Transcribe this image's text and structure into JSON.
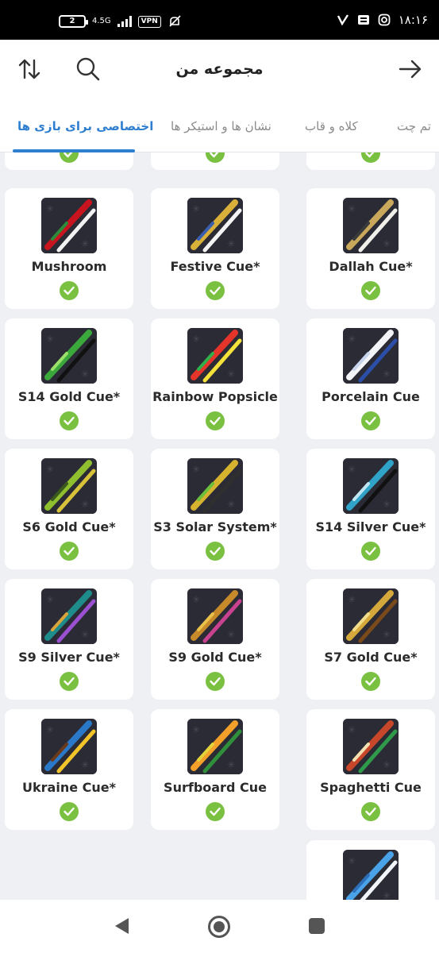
{
  "status_bar": {
    "battery": "2",
    "network": "4.5G",
    "vpn": "VPN",
    "time": "۱۸:۱۶"
  },
  "app_bar": {
    "title": "مجموعه من"
  },
  "tabs": [
    {
      "label": "اختصاصی برای بازی ها",
      "active": true
    },
    {
      "label": "نشان ها و استیکر ها",
      "active": false
    },
    {
      "label": "کلاه و قاب",
      "active": false
    },
    {
      "label": "تم چت",
      "active": false
    }
  ],
  "items": [
    {
      "name": "Mushroom",
      "icon": "cue-mushroom",
      "colors": [
        "#c8141e",
        "#f2f2f2",
        "#2e8b3a"
      ],
      "owned": true
    },
    {
      "name": "Festive Cue*",
      "icon": "cue-festive",
      "colors": [
        "#d9b13a",
        "#f4f4f4",
        "#3a5fb0"
      ],
      "owned": true
    },
    {
      "name": "Dallah Cue*",
      "icon": "cue-dallah",
      "colors": [
        "#c9a85b",
        "#f1efe9",
        "#3a3a3a"
      ],
      "owned": true
    },
    {
      "name": "S14 Gold Cue*",
      "icon": "cue-s14-gold",
      "colors": [
        "#3aa83a",
        "#111111",
        "#9be06a"
      ],
      "owned": true
    },
    {
      "name": "Rainbow Popsicle",
      "icon": "cue-rainbow",
      "colors": [
        "#e5352b",
        "#f4e23a",
        "#2fb04a"
      ],
      "owned": true
    },
    {
      "name": "Porcelain Cue",
      "icon": "cue-porcelain",
      "colors": [
        "#f2f4f8",
        "#2b4fa8",
        "#c8d4ee"
      ],
      "owned": true
    },
    {
      "name": "S6 Gold Cue*",
      "icon": "cue-s6-gold",
      "colors": [
        "#8fbf2e",
        "#d7c23a",
        "#3a5a1e"
      ],
      "owned": true
    },
    {
      "name": "S3 Solar System*",
      "icon": "cue-solar",
      "colors": [
        "#d6b32e",
        "#2f2f2f",
        "#6bbf3a"
      ],
      "owned": true
    },
    {
      "name": "S14 Silver Cue*",
      "icon": "cue-s14-silver",
      "colors": [
        "#2fa3c8",
        "#111111",
        "#bfe6f2"
      ],
      "owned": true
    },
    {
      "name": "S9 Silver Cue*",
      "icon": "cue-s9-silver",
      "colors": [
        "#1f8c8c",
        "#9b4fd1",
        "#d9a43a"
      ],
      "owned": true
    },
    {
      "name": "S9 Gold Cue*",
      "icon": "cue-s9-gold",
      "colors": [
        "#c78a2a",
        "#c8428f",
        "#e8c04a"
      ],
      "owned": true
    },
    {
      "name": "S7 Gold Cue*",
      "icon": "cue-s7-gold",
      "colors": [
        "#d4a83a",
        "#7a4a1a",
        "#f0dc8a"
      ],
      "owned": true
    },
    {
      "name": "Ukraine Cue*",
      "icon": "cue-ukraine",
      "colors": [
        "#2a78c8",
        "#f2c42a",
        "#6a3a1a"
      ],
      "owned": true
    },
    {
      "name": "Surfboard Cue",
      "icon": "cue-surfboard",
      "colors": [
        "#f2a02a",
        "#2f8f3a",
        "#e4d23a"
      ],
      "owned": true
    },
    {
      "name": "Spaghetti Cue",
      "icon": "cue-spaghetti",
      "colors": [
        "#c8462a",
        "#2f9a4a",
        "#f2e0b0"
      ],
      "owned": true
    },
    {
      "name": "",
      "icon": "cue-ribbon",
      "colors": [
        "#4aa3e8",
        "#f2f6fb",
        "#2d6fb8"
      ],
      "owned": false
    }
  ],
  "theme": {
    "accent": "#2f7fd1",
    "check": "#7ac142",
    "background": "#eef0f4"
  }
}
